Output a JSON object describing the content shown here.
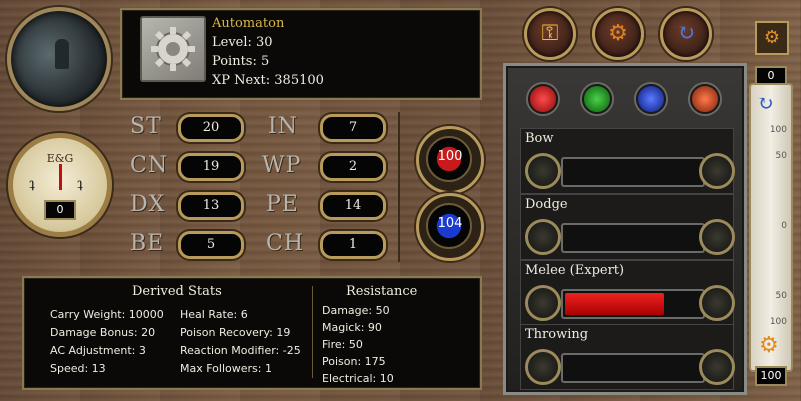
{
  "character": {
    "name": "Automaton",
    "level": "Level: 30",
    "points": "Points: 5",
    "xp_next": "XP Next: 385100",
    "portrait_icon": "character-portrait",
    "class_icon": "gear-icon"
  },
  "top_buttons": [
    {
      "icon": "key-icon"
    },
    {
      "icon": "gear-icon"
    },
    {
      "icon": "cycle-icon"
    }
  ],
  "corner_icon": "tech-icon",
  "stats": {
    "st": {
      "label": "ST",
      "value": "20"
    },
    "cn": {
      "label": "CN",
      "value": "19"
    },
    "dx": {
      "label": "DX",
      "value": "13"
    },
    "be": {
      "label": "BE",
      "value": "5"
    },
    "in": {
      "label": "IN",
      "value": "7"
    },
    "wp": {
      "label": "WP",
      "value": "2"
    },
    "pe": {
      "label": "PE",
      "value": "14"
    },
    "ch": {
      "label": "CH",
      "value": "1"
    }
  },
  "health": "100",
  "fatigue": "104",
  "dial": {
    "label": "E&G",
    "value": "0",
    "left_mark": "ʇ",
    "right_mark": "ʇ"
  },
  "derived": {
    "title": "Derived Stats",
    "col1": [
      "Carry Weight: 10000",
      "Damage Bonus: 20",
      "AC Adjustment: 3",
      "Speed: 13"
    ],
    "col2": [
      "Heal Rate: 6",
      "Poison Recovery: 19",
      "Reaction Modifier: -25",
      "Max Followers: 1"
    ]
  },
  "resistance": {
    "title": "Resistance",
    "items": [
      "Damage: 50",
      "Magick: 90",
      "Fire: 50",
      "Poison: 175",
      "Electrical: 10"
    ]
  },
  "skill_tabs": [
    {
      "icon": "shield-icon",
      "color": "#c21a1a"
    },
    {
      "icon": "mask-icon",
      "color": "#1f8a2a"
    },
    {
      "icon": "book-icon",
      "color": "#2246b0"
    },
    {
      "icon": "gear-icon",
      "color": "#b8401a"
    }
  ],
  "skills": [
    {
      "name": "Bow",
      "fill": 0
    },
    {
      "name": "Dodge",
      "fill": 0
    },
    {
      "name": "Melee (Expert)",
      "fill": 0.75
    },
    {
      "name": "Throwing",
      "fill": 0
    }
  ],
  "alignment": {
    "top_value": "0",
    "bottom_value": "100",
    "ticks": [
      "100",
      "50",
      "0",
      "50",
      "100"
    ]
  }
}
